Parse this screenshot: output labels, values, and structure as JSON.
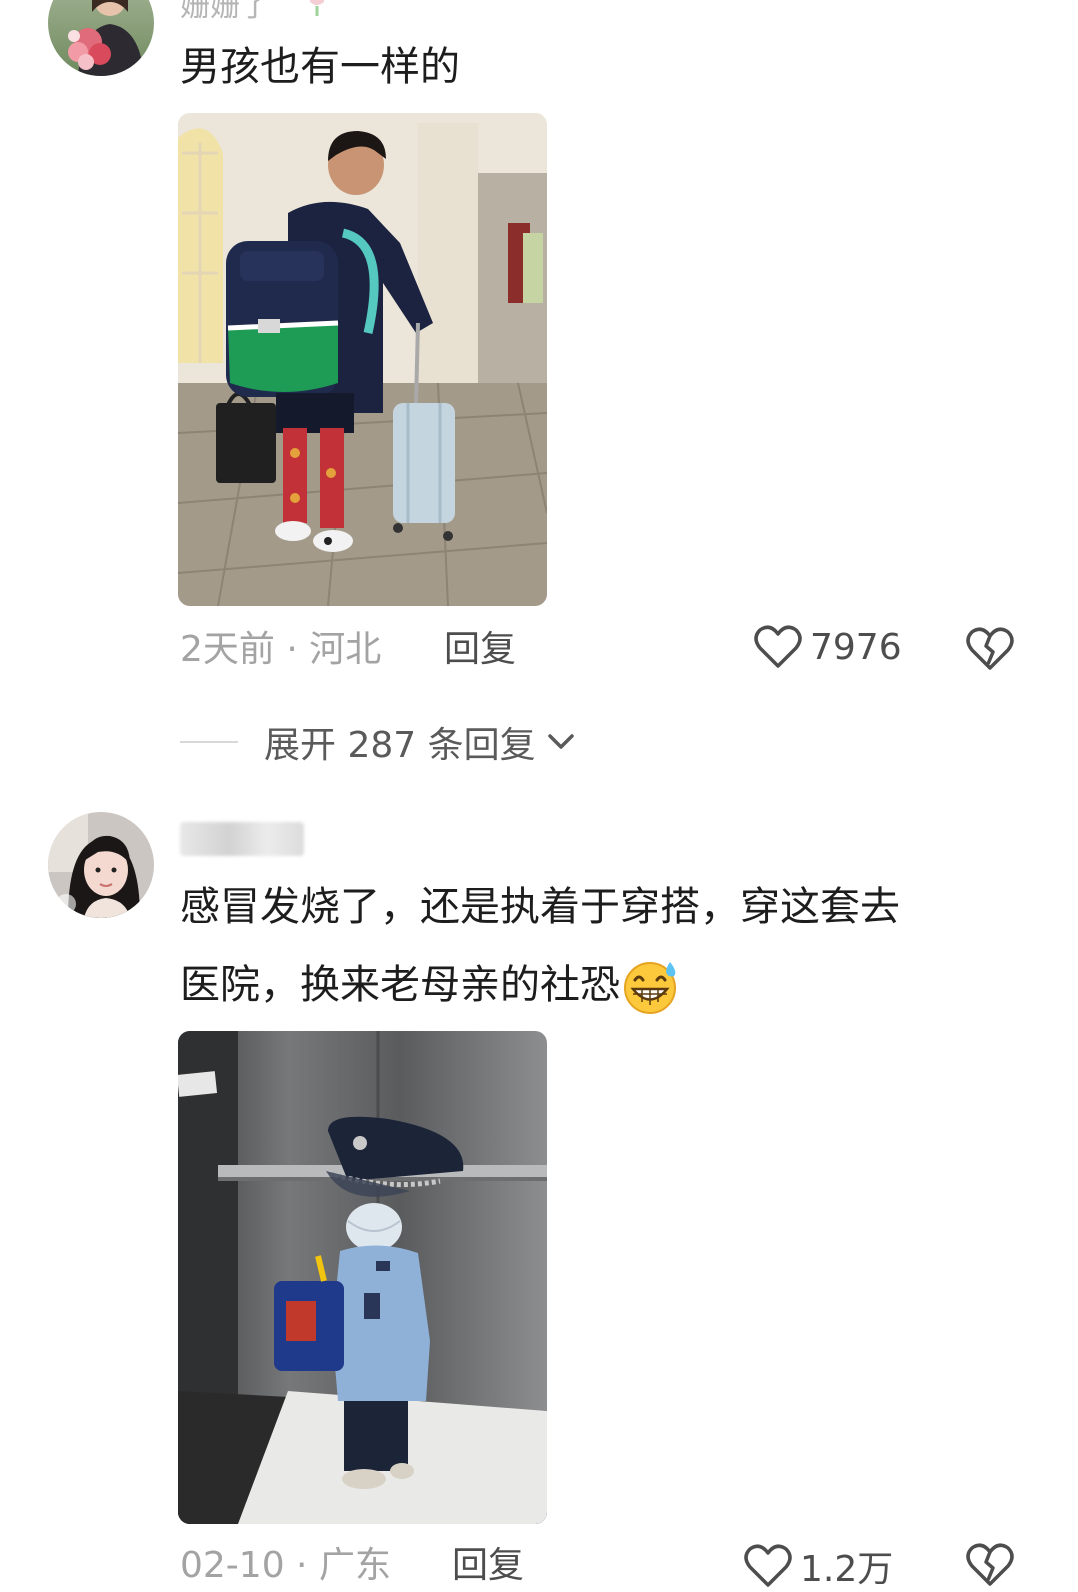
{
  "comments": [
    {
      "username": "姗姗了",
      "text": "男孩也有一样的",
      "time_location": "2天前 · 河北",
      "reply_label": "回复",
      "likes": "7976",
      "expand_label": "展开 287 条回复",
      "icons": {
        "like": "heart-outline-icon",
        "dislike": "broken-heart-icon",
        "expand": "chevron-down-icon"
      }
    },
    {
      "username": "",
      "text_line1": "感冒发烧了，还是执着于穿搭，穿这套去",
      "text_line2": "医院，换来老母亲的社恐",
      "emoji": "grinning-sweat-emoji",
      "time_location": "02-10 · 广东",
      "reply_label": "回复",
      "likes": "1.2万",
      "icons": {
        "like": "heart-outline-icon",
        "dislike": "broken-heart-icon"
      }
    }
  ],
  "colors": {
    "meta": "#a3a3a3",
    "text": "#1d1d1d",
    "secondary": "#4d4d4d"
  }
}
